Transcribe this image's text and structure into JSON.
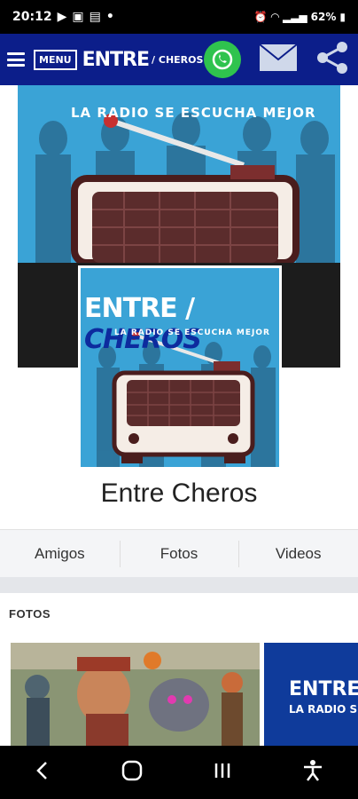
{
  "status": {
    "time": "20:12",
    "battery": "62%"
  },
  "app_bar": {
    "menu_label": "MENU",
    "brand": "ENTRE",
    "brand_sub": "/ CHEROS"
  },
  "cover": {
    "tagline": "LA RADIO SE ESCUCHA MEJOR"
  },
  "profile_pic": {
    "title_a": "ENTRE",
    "title_b": "CHEROS",
    "tagline": "LA RADIO SE ESCUCHA MEJOR"
  },
  "profile": {
    "name": "Entre Cheros"
  },
  "tabs": [
    {
      "label": "Amigos"
    },
    {
      "label": "Fotos"
    },
    {
      "label": "Videos"
    }
  ],
  "fotos": {
    "header": "FOTOS",
    "photo2_title": "ENTRE",
    "photo2_sub": "LA RADIO S"
  },
  "colors": {
    "app_bar": "#0c1e8a",
    "whatsapp": "#2fc34e",
    "cover_blue": "#3aa3d6"
  },
  "icons": [
    "hamburger-icon",
    "whatsapp-icon",
    "mail-icon",
    "share-icon",
    "back-icon",
    "home-icon",
    "recents-icon",
    "accessibility-icon"
  ]
}
